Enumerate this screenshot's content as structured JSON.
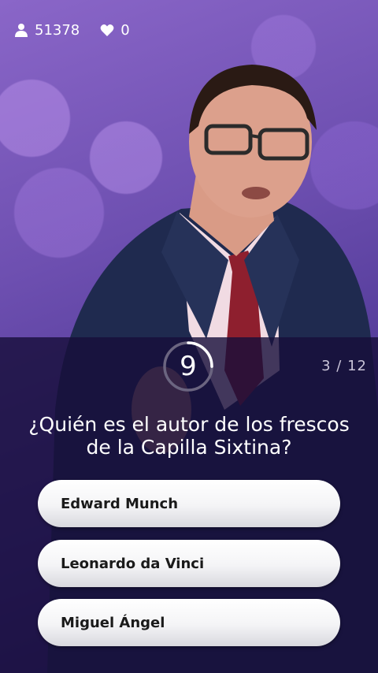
{
  "stats": {
    "viewers": "51378",
    "lives": "0"
  },
  "timer": {
    "seconds": "9",
    "progress": 0.25
  },
  "question_counter": "3 / 12",
  "question": "¿Quién es el autor de los frescos de la Capilla Sixtina?",
  "answers": [
    {
      "label": "Edward Munch"
    },
    {
      "label": "Leonardo da Vinci"
    },
    {
      "label": "Miguel Ángel"
    }
  ],
  "colors": {
    "panel": "#160e3a",
    "background": "#6d4fb0",
    "answer_bg": "#ffffff",
    "timer_ring": "#ffffff"
  },
  "icons": [
    "user-icon",
    "heart-icon"
  ]
}
